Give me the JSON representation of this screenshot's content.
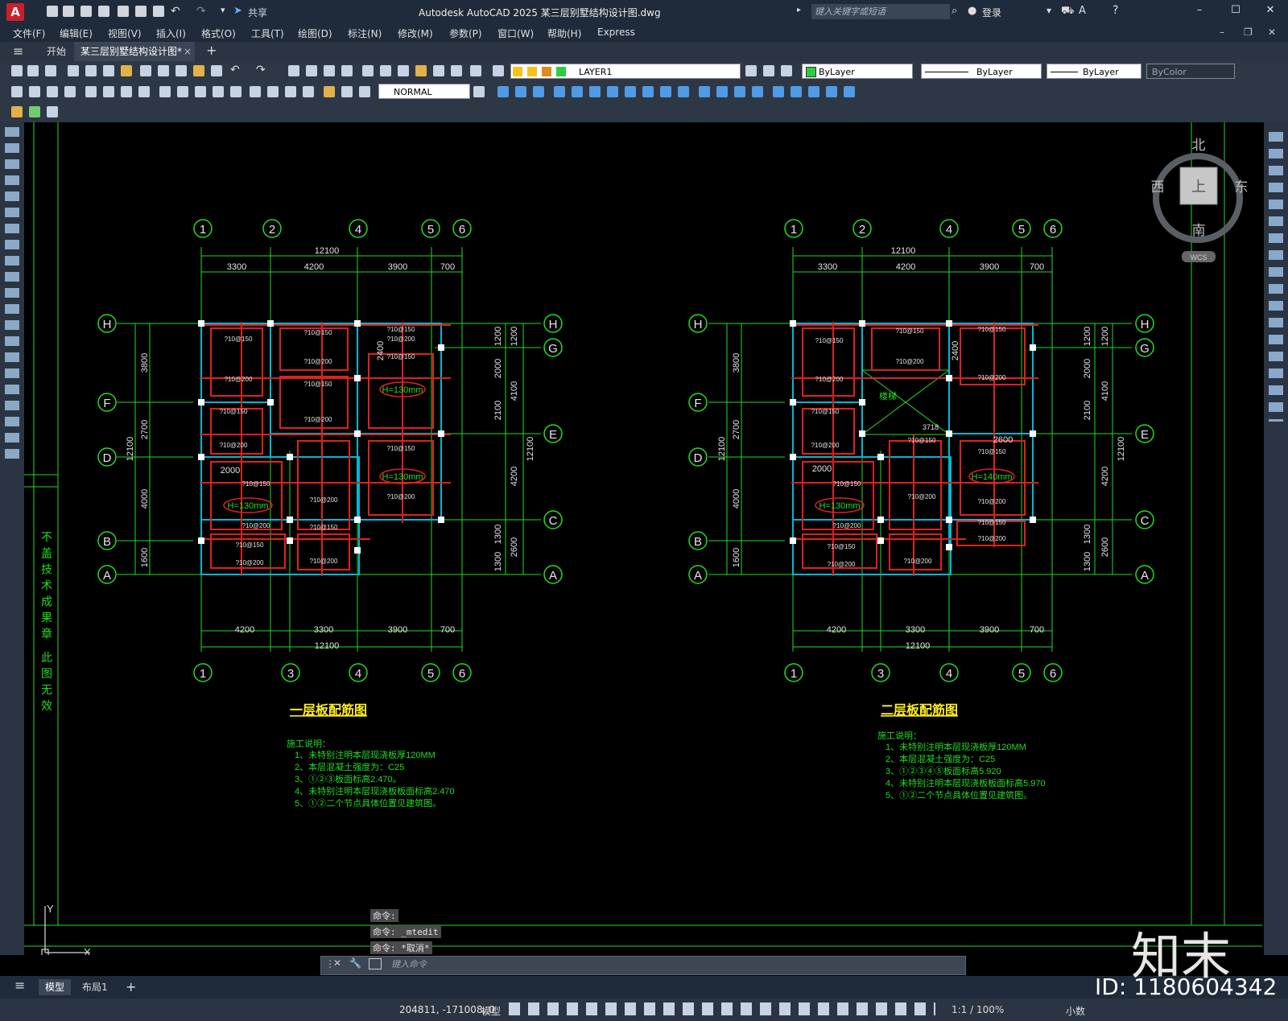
{
  "titlebar": {
    "logo": "A",
    "share": "共享",
    "title": "Autodesk AutoCAD 2025    某三层别墅结构设计图.dwg",
    "search_placeholder": "键入关键字或短语",
    "login": "登录"
  },
  "menus": [
    "文件(F)",
    "编辑(E)",
    "视图(V)",
    "插入(I)",
    "格式(O)",
    "工具(T)",
    "绘图(D)",
    "标注(N)",
    "修改(M)",
    "参数(P)",
    "窗口(W)",
    "帮助(H)",
    "Express"
  ],
  "tabs": {
    "start": "开始",
    "doc": "某三层别墅结构设计图*",
    "add": "+"
  },
  "toolbar": {
    "layer": "LAYER1",
    "color": "ByLayer",
    "linetype": "ByLayer",
    "lineweight": "ByLayer",
    "plotstyle": "ByColor",
    "dimstyle": "NORMAL"
  },
  "compass": {
    "north": "北",
    "south": "南",
    "east": "东",
    "west": "西",
    "top": "上",
    "wcs": "WCS"
  },
  "drawing": {
    "axes_top": [
      "1",
      "2",
      "4",
      "5",
      "6"
    ],
    "axes_bottom": [
      "1",
      "3",
      "4",
      "5",
      "6"
    ],
    "axes_left": [
      "H",
      "F",
      "D",
      "B",
      "A"
    ],
    "axes_right": [
      "H",
      "G",
      "E",
      "C",
      "A"
    ],
    "top_total": "12100",
    "top_dims": [
      "3300",
      "4200",
      "3900",
      "700"
    ],
    "bottom_dims": [
      "4200",
      "3300",
      "3900",
      "700"
    ],
    "bottom_total": "12100",
    "left_dims": [
      "3800",
      "2700",
      "4000",
      "1600"
    ],
    "left_total": "12100",
    "right_dims_1": [
      "1200",
      "2000",
      "2100",
      "1300",
      "1300"
    ],
    "right_dims_2": [
      "1200",
      "4100",
      "4200",
      "2600"
    ],
    "right_total": "12100",
    "plan1": {
      "title": "一层板配筋图",
      "notes_head": "施工说明：",
      "notes": [
        "1、未特别注明本层现浇板厚120MM",
        "2、本层混凝土强度为：C25",
        "3、①②③板面标高2.470。",
        "4、未特别注明本层现浇板板面标高2.470",
        "5、①②二个节点具体位置见建筑图。"
      ],
      "h_labels": [
        "H=130mm",
        "H=130mm",
        "H=130mm"
      ],
      "dim_2000": "2000",
      "dim_2400": "2400"
    },
    "plan2": {
      "title": "二层板配筋图",
      "notes_head": "施工说明：",
      "notes": [
        "1、未特别注明本层现浇板厚120MM",
        "2、本层混凝土强度为：C25",
        "3、①②③④⑤板面标高5.920",
        "4、未特别注明本层现浇板板面标高5.970",
        "5、①②二个节点具体位置见建筑图。"
      ],
      "h_labels": [
        "H=140mm",
        "H=130mm"
      ],
      "dim_2000": "2000",
      "dim_2400": "2400",
      "dim_2600": "2600",
      "dim_3718": "3718",
      "stair": "楼梯"
    },
    "side_text": "不盖技术成果章 此图无效",
    "rebar": [
      "?10@150",
      "?10@200"
    ]
  },
  "command": {
    "history": [
      "命令:",
      "命令: _mtedit",
      "命令: *取消*"
    ],
    "placeholder": "键入命令"
  },
  "layout_tabs": {
    "model": "模型",
    "layout1": "布局1",
    "add": "+"
  },
  "status": {
    "coords": "204811, -171008, 0",
    "model": "模型",
    "scale": "1:1 / 100%",
    "units": "小数"
  },
  "watermark": {
    "brand": "知末",
    "id": "ID: 1180604342"
  }
}
